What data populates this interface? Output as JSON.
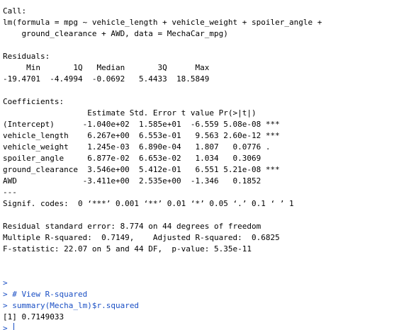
{
  "output": {
    "call_header": "Call:",
    "call_line1": "lm(formula = mpg ~ vehicle_length + vehicle_weight + spoiler_angle +",
    "call_line2": "    ground_clearance + AWD, data = MechaCar_mpg)",
    "residuals_header": "Residuals:",
    "residuals_cols": "     Min       1Q   Median       3Q      Max ",
    "residuals_vals": "-19.4701  -4.4994  -0.0692   5.4433  18.5849 ",
    "coef_header": "Coefficients:",
    "coef_cols": "                  Estimate Std. Error t value Pr(>|t|)    ",
    "coef_rows": [
      "(Intercept)      -1.040e+02  1.585e+01  -6.559 5.08e-08 ***",
      "vehicle_length    6.267e+00  6.553e-01   9.563 2.60e-12 ***",
      "vehicle_weight    1.245e-03  6.890e-04   1.807   0.0776 .  ",
      "spoiler_angle     6.877e-02  6.653e-02   1.034   0.3069    ",
      "ground_clearance  3.546e+00  5.412e-01   6.551 5.21e-08 ***",
      "AWD              -3.411e+00  2.535e+00  -1.346   0.1852    "
    ],
    "separator": "---",
    "signif_codes": "Signif. codes:  0 ‘***’ 0.001 ‘**’ 0.01 ‘*’ 0.05 ‘.’ 0.1 ‘ ’ 1",
    "rse": "Residual standard error: 8.774 on 44 degrees of freedom",
    "r_squared": "Multiple R-squared:  0.7149,\tAdjusted R-squared:  0.6825 ",
    "f_stat": "F-statistic: 22.07 on 5 and 44 DF,  p-value: 5.35e-11"
  },
  "session": {
    "prompt": "> ",
    "empty_prompt": ">",
    "comment_cmd": "# View R-squared",
    "summary_cmd": "summary(Mecha_lm)$r.squared",
    "result": "[1] 0.7149033"
  }
}
